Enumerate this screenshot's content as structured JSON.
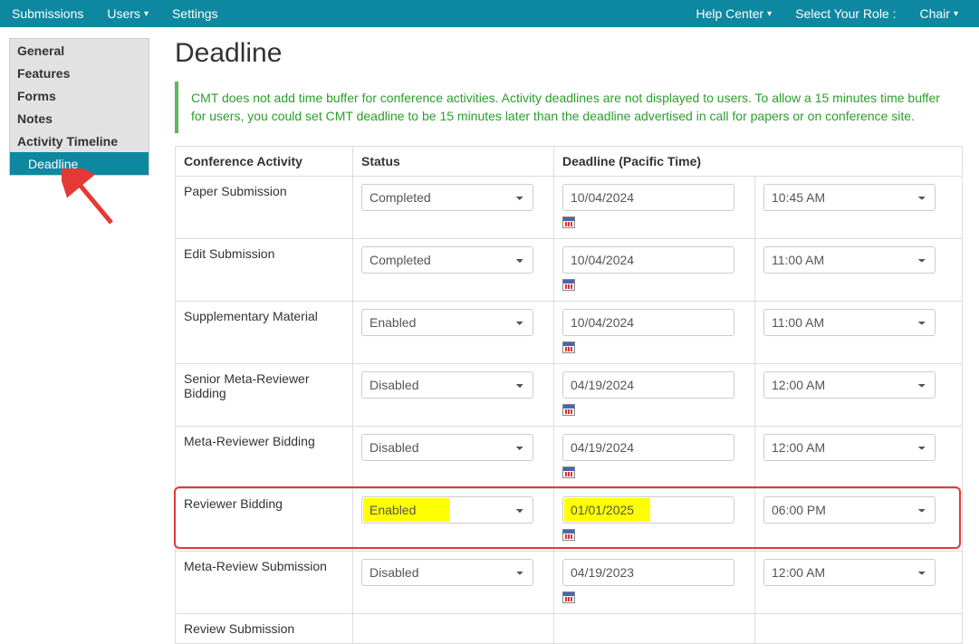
{
  "topbar": {
    "left": [
      {
        "label": "Submissions",
        "caret": false
      },
      {
        "label": "Users",
        "caret": true
      },
      {
        "label": "Settings",
        "caret": false
      }
    ],
    "right": [
      {
        "label": "Help Center",
        "caret": true
      },
      {
        "label": "Select Your Role :",
        "caret": false
      },
      {
        "label": "Chair",
        "caret": true
      }
    ]
  },
  "sidebar": {
    "items": [
      {
        "label": "General",
        "active": false
      },
      {
        "label": "Features",
        "active": false
      },
      {
        "label": "Forms",
        "active": false
      },
      {
        "label": "Notes",
        "active": false
      },
      {
        "label": "Activity Timeline",
        "active": false
      },
      {
        "label": "Deadline",
        "active": true
      }
    ]
  },
  "page": {
    "title": "Deadline",
    "info": "CMT does not add time buffer for conference activities. Activity deadlines are not displayed to users. To allow a 15 minutes time buffer for users, you could set CMT deadline to be 15 minutes later than the deadline advertised in call for papers or on conference site."
  },
  "table_headers": {
    "activity": "Conference Activity",
    "status": "Status",
    "deadline": "Deadline (Pacific Time)"
  },
  "rows": [
    {
      "activity": "Paper Submission",
      "status": "Completed",
      "date": "10/04/2024",
      "time": "10:45 AM",
      "highlighted": false
    },
    {
      "activity": "Edit Submission",
      "status": "Completed",
      "date": "10/04/2024",
      "time": "11:00 AM",
      "highlighted": false
    },
    {
      "activity": "Supplementary Material",
      "status": "Enabled",
      "date": "10/04/2024",
      "time": "11:00 AM",
      "highlighted": false
    },
    {
      "activity": "Senior Meta-Reviewer Bidding",
      "status": "Disabled",
      "date": "04/19/2024",
      "time": "12:00 AM",
      "highlighted": false
    },
    {
      "activity": "Meta-Reviewer Bidding",
      "status": "Disabled",
      "date": "04/19/2024",
      "time": "12:00 AM",
      "highlighted": false
    },
    {
      "activity": "Reviewer Bidding",
      "status": "Enabled",
      "date": "01/01/2025",
      "time": "06:00 PM",
      "highlighted": true
    },
    {
      "activity": "Meta-Review Submission",
      "status": "Disabled",
      "date": "04/19/2023",
      "time": "12:00 AM",
      "highlighted": false
    },
    {
      "activity": "Review Submission",
      "status": "",
      "date": "",
      "time": "",
      "highlighted": false,
      "partial": true
    }
  ]
}
